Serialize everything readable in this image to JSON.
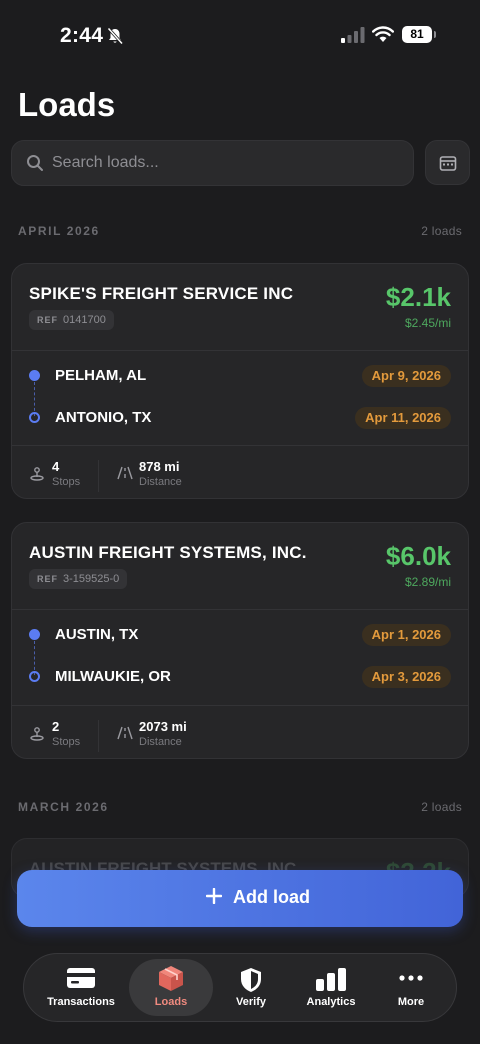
{
  "status_bar": {
    "time": "2:44",
    "battery": "81"
  },
  "header": {
    "title": "Loads"
  },
  "search": {
    "placeholder": "Search loads..."
  },
  "sections": [
    {
      "label": "APRIL 2026",
      "count": "2 loads"
    },
    {
      "label": "MARCH 2026",
      "count": "2 loads"
    }
  ],
  "loads": [
    {
      "company": "SPIKE'S FREIGHT SERVICE INC",
      "ref_label": "REF",
      "ref": "0141700",
      "price": "$2.1k",
      "rate": "$2.45/mi",
      "origin": {
        "city": "PELHAM, AL",
        "date": "Apr 9, 2026"
      },
      "destination": {
        "city": "ANTONIO, TX",
        "date": "Apr 11, 2026"
      },
      "stops": {
        "value": "4",
        "label": "Stops"
      },
      "distance": {
        "value": "878 mi",
        "label": "Distance"
      }
    },
    {
      "company": "AUSTIN FREIGHT SYSTEMS, INC.",
      "ref_label": "REF",
      "ref": "3-159525-0",
      "price": "$6.0k",
      "rate": "$2.89/mi",
      "origin": {
        "city": "AUSTIN, TX",
        "date": "Apr 1, 2026"
      },
      "destination": {
        "city": "MILWAUKIE, OR",
        "date": "Apr 3, 2026"
      },
      "stops": {
        "value": "2",
        "label": "Stops"
      },
      "distance": {
        "value": "2073 mi",
        "label": "Distance"
      }
    }
  ],
  "partial_card": {
    "company": "AUSTIN FREIGHT SYSTEMS, INC.",
    "price": "$3.2k"
  },
  "actions": {
    "add_load": "Add load"
  },
  "tabs": [
    {
      "label": "Transactions",
      "icon": "card-icon",
      "active": false
    },
    {
      "label": "Loads",
      "icon": "box-icon",
      "active": true
    },
    {
      "label": "Verify",
      "icon": "shield-icon",
      "active": false
    },
    {
      "label": "Analytics",
      "icon": "bar-chart-icon",
      "active": false
    },
    {
      "label": "More",
      "icon": "more-icon",
      "active": false
    }
  ],
  "colors": {
    "background": "#1c1c1e",
    "price_green": "#58c66a",
    "accent_blue": "#5b7cf2",
    "date_orange": "#e39a3c",
    "active_tab": "#f08a7f"
  }
}
